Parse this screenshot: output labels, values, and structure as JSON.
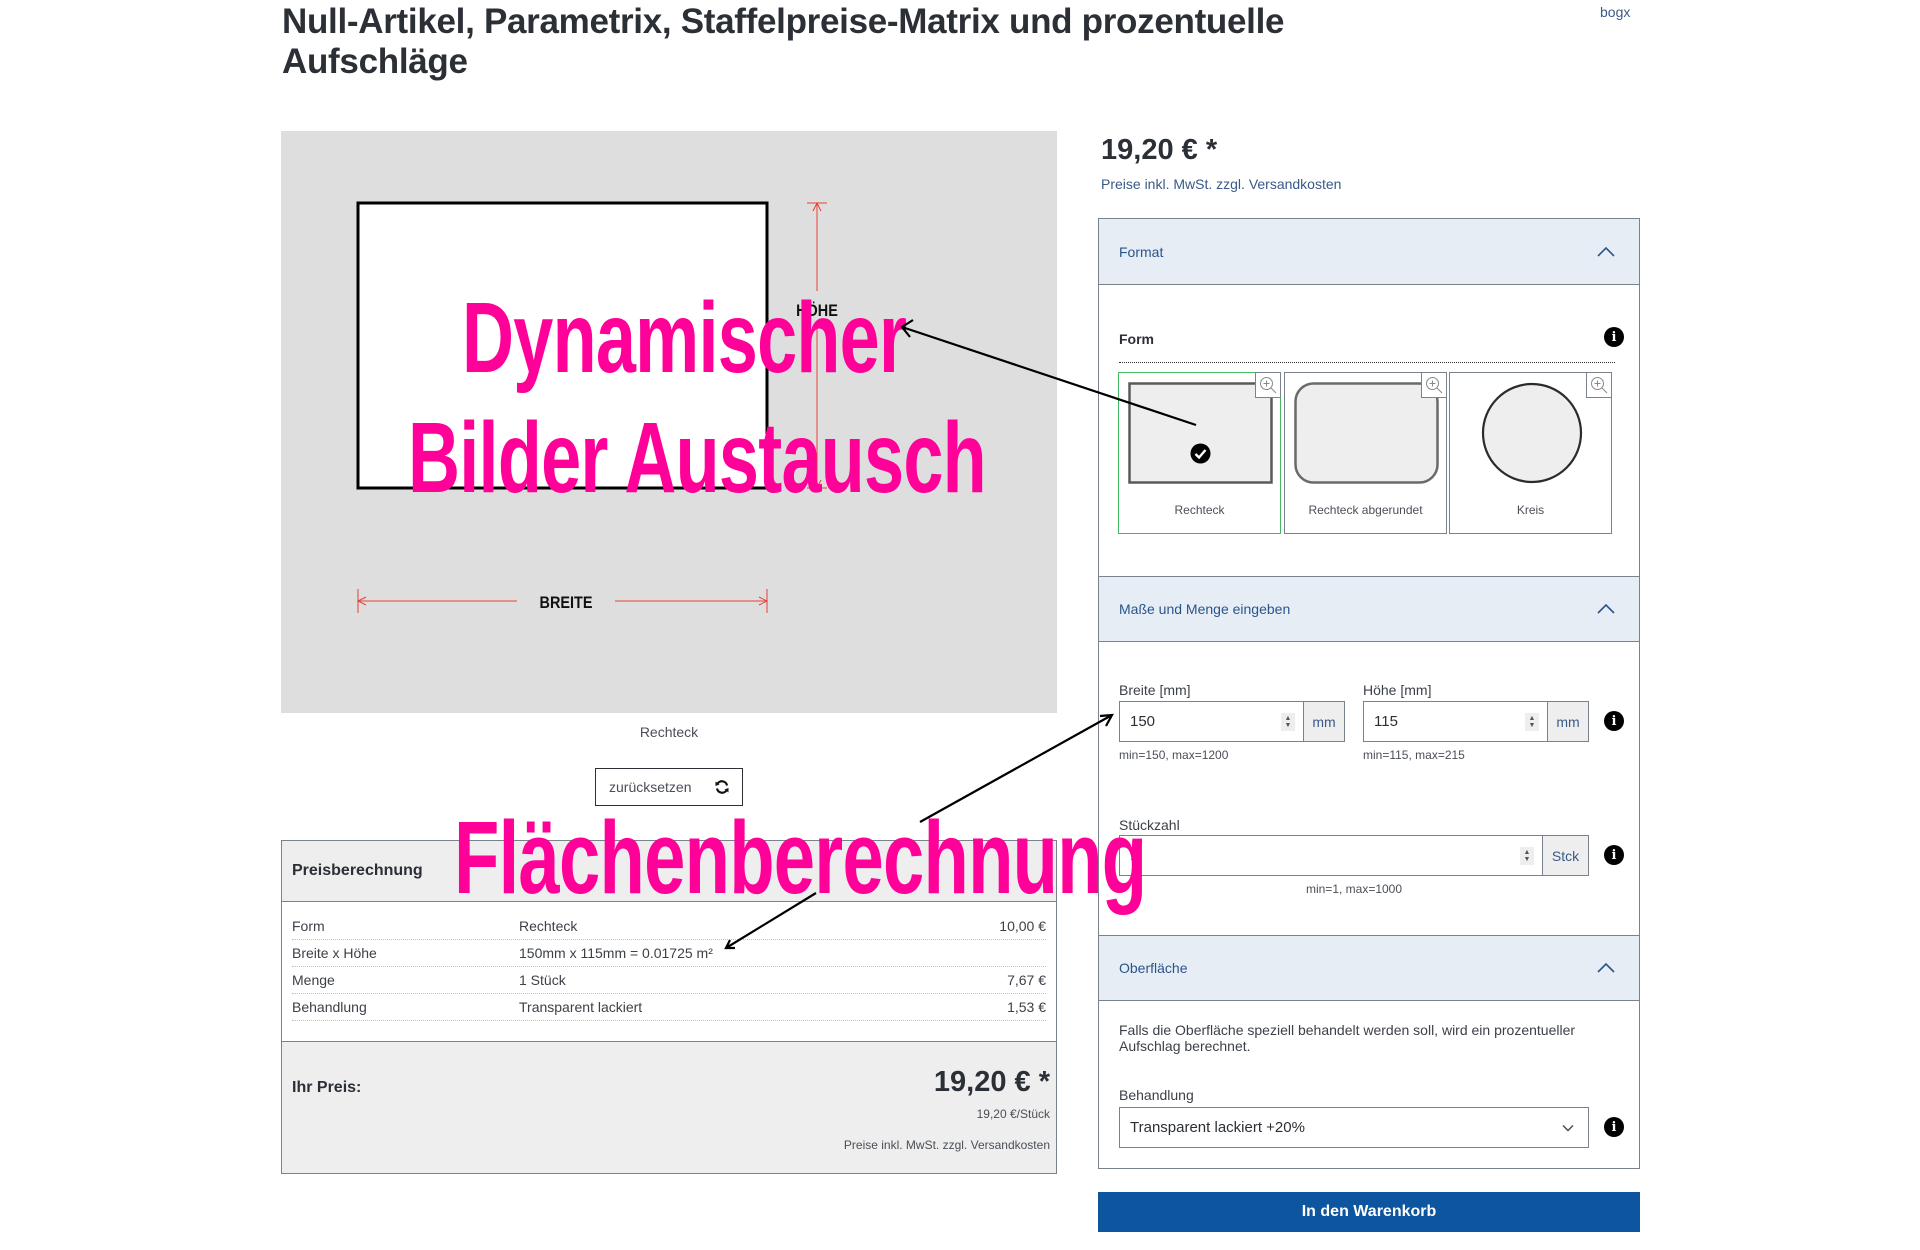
{
  "page": {
    "title": "Null-Artikel, Parametrix, Staffelpreise-Matrix und prozentuelle Aufschläge",
    "vendor": "bogx"
  },
  "product_image": {
    "label_width": "BREITE",
    "label_height": "HÖHE",
    "caption": "Rechteck",
    "reset_label": "zurücksetzen",
    "reset_icon": "refresh-icon"
  },
  "annotations": {
    "image_swap_line1": "Dynamischer",
    "image_swap_line2": "Bilder Austausch",
    "area_calc": "Flächenberechnung",
    "color": "#ff0099"
  },
  "price_calc": {
    "title": "Preisberechnung",
    "rows": [
      {
        "label": "Form",
        "value": "Rechteck",
        "price": "10,00 €"
      },
      {
        "label": "Breite x Höhe",
        "value": "150mm x 115mm = 0.01725 m²",
        "price": ""
      },
      {
        "label": "Menge",
        "value": "1 Stück",
        "price": "7,67 €"
      },
      {
        "label": "Behandlung",
        "value": "Transparent lackiert",
        "price": "1,53 €"
      }
    ],
    "your_price_label": "Ihr Preis:",
    "your_price": "19,20 € *",
    "unit_price": "19,20 €/Stück",
    "tax_note": "Preise inkl. MwSt. zzgl. Versandkosten"
  },
  "buybox": {
    "price": "19,20 € *",
    "tax_note": "Preise inkl. MwSt. zzgl. Versandkosten"
  },
  "config": {
    "sections": [
      {
        "title": "Format",
        "expanded": true
      },
      {
        "title": "Maße und Menge eingeben",
        "expanded": true
      },
      {
        "title": "Oberfläche",
        "expanded": true
      }
    ],
    "format": {
      "form_label": "Form",
      "options": [
        {
          "label": "Rechteck",
          "selected": true
        },
        {
          "label": "Rechteck abgerundet",
          "selected": false
        },
        {
          "label": "Kreis",
          "selected": false
        }
      ]
    },
    "dimensions": {
      "width": {
        "label": "Breite [mm]",
        "value": "150",
        "unit": "mm",
        "hint": "min=150, max=1200"
      },
      "height": {
        "label": "Höhe [mm]",
        "value": "115",
        "unit": "mm",
        "hint": "min=115, max=215"
      },
      "quantity": {
        "label": "Stückzahl",
        "value": "1",
        "unit": "Stck",
        "hint": "min=1, max=1000"
      }
    },
    "surface": {
      "description": "Falls die Oberfläche speziell behandelt werden soll, wird ein prozentueller Aufschlag berechnet.",
      "treatment_label": "Behandlung",
      "treatment_selected": "Transparent lackiert +20%"
    }
  },
  "cart_button": "In den Warenkorb",
  "colors": {
    "accent": "#0d559f",
    "header_bg": "#e6edf5",
    "selected_border": "#43b964",
    "annotation": "#ff0099",
    "dimension_lines": "#e8413a"
  }
}
